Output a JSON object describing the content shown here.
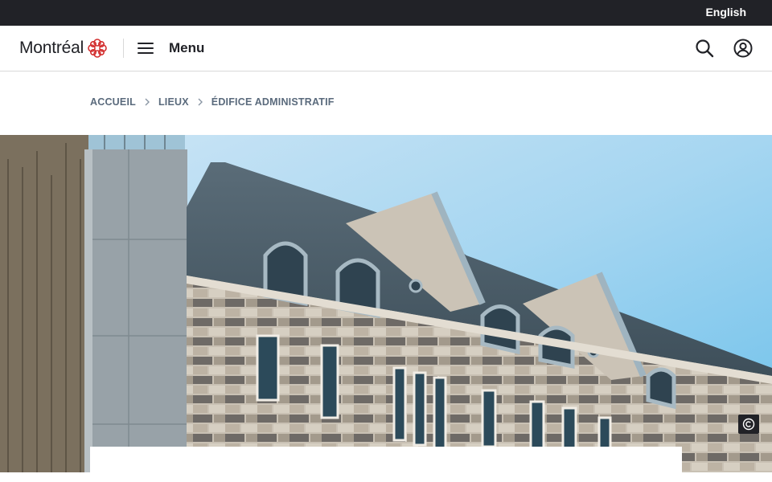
{
  "topbar": {
    "language_link": "English"
  },
  "header": {
    "logo_text": "Montréal",
    "menu_label": "Menu",
    "icons": {
      "logo_mark": "montreal-rosette-icon",
      "menu": "hamburger-icon",
      "search": "search-icon",
      "account": "user-account-icon"
    }
  },
  "breadcrumb": {
    "items": [
      "ACCUEIL",
      "LIEUX",
      "ÉDIFICE ADMINISTRATIF"
    ]
  },
  "hero": {
    "subject": "building-facade-image",
    "copyright_icon": "copyright-icon"
  },
  "colors": {
    "topbar_bg": "#212227",
    "brand_red": "#d32f2f",
    "breadcrumb_text": "#5a6a7c",
    "sky": "#7fc4ea"
  }
}
